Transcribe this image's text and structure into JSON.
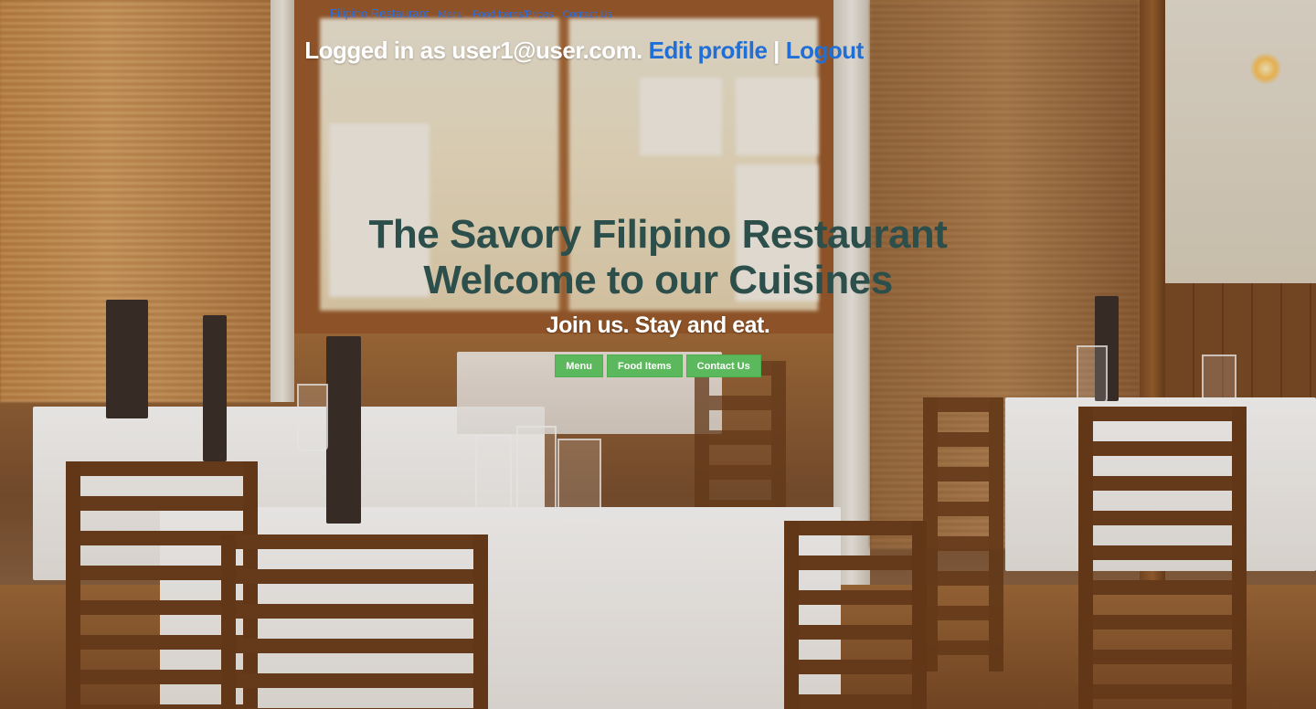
{
  "nav": {
    "brand": "Filipino Restaurant",
    "links": [
      "Menu",
      "Food Items/Prices",
      "Contact Us"
    ]
  },
  "login": {
    "prefix": "Logged in as user1@user.com.",
    "edit_profile": "Edit profile",
    "separator": "|",
    "logout": "Logout"
  },
  "hero": {
    "title_line1": "The Savory Filipino Restaurant",
    "title_line2": "Welcome to our Cuisines",
    "tagline": "Join us. Stay and eat.",
    "buttons": [
      "Menu",
      "Food Items",
      "Contact Us"
    ]
  },
  "colors": {
    "link_blue": "#2e6fe0",
    "title_teal": "#2c4f4c",
    "button_green": "#5cb85c"
  }
}
